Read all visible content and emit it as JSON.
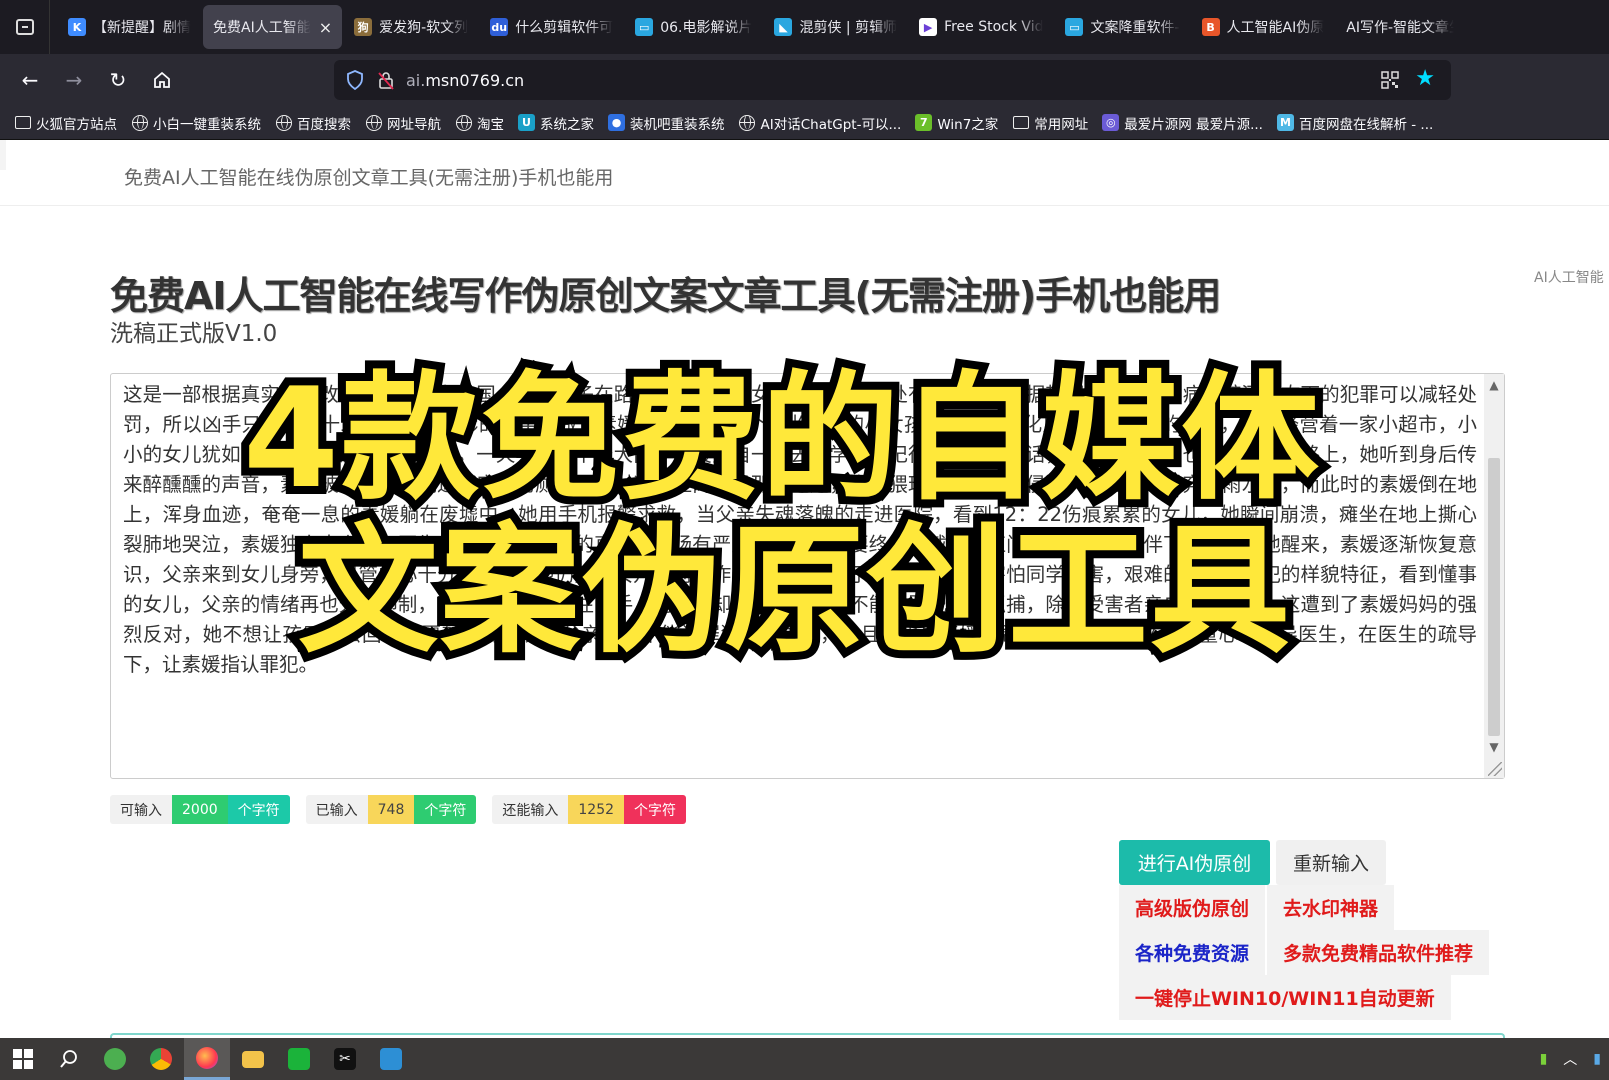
{
  "browser": {
    "tabs": [
      {
        "title": "【新提醒】剧情",
        "favicon": "k-logo-icon",
        "color": "#3f8cff",
        "glyph": "K",
        "active": false
      },
      {
        "title": "免费AI人工智能",
        "favicon": "",
        "color": "",
        "glyph": "",
        "active": true,
        "close": "×"
      },
      {
        "title": "爱发狗-软文列",
        "favicon": "dog-icon",
        "color": "#8b6d3b",
        "glyph": "狗",
        "active": false
      },
      {
        "title": "什么剪辑软件可",
        "favicon": "baidu-paw-icon",
        "color": "#2f5fd8",
        "glyph": "du",
        "active": false
      },
      {
        "title": "06.电影解说片",
        "favicon": "bilibili-tv-icon",
        "color": "#2aa7e0",
        "glyph": "▭",
        "active": false
      },
      {
        "title": "混剪侠 | 剪辑师",
        "favicon": "hunjianxia-icon",
        "color": "#2aa7e0",
        "glyph": "◣",
        "active": false
      },
      {
        "title": "Free Stock Vid",
        "favicon": "play-icon",
        "color": "#ffffff",
        "glyph": "▶",
        "active": false
      },
      {
        "title": "文案降重软件-",
        "favicon": "bilibili-tv-icon",
        "color": "#2aa7e0",
        "glyph": "▭",
        "active": false
      },
      {
        "title": "人工智能AI伪原",
        "favicon": "b-logo-icon",
        "color": "#e8562a",
        "glyph": "B",
        "active": false
      },
      {
        "title": "AI写作-智能文章生",
        "favicon": "",
        "color": "",
        "glyph": "",
        "active": false
      }
    ],
    "url_host_prefix": "ai.",
    "url_host_rest": "msn0769.cn",
    "bookmarks": [
      {
        "label": "火狐官方站点",
        "icon": "folder"
      },
      {
        "label": "小白一键重装系统",
        "icon": "globe"
      },
      {
        "label": "百度搜索",
        "icon": "globe"
      },
      {
        "label": "网址导航",
        "icon": "globe"
      },
      {
        "label": "淘宝",
        "icon": "globe"
      },
      {
        "label": "系统之家",
        "icon": "sq",
        "color": "#1aa0c8",
        "glyph": "U"
      },
      {
        "label": "装机吧重装系统",
        "icon": "sq",
        "color": "#2f6fe0",
        "glyph": "●"
      },
      {
        "label": "AI对话ChatGpt-可以...",
        "icon": "globe"
      },
      {
        "label": "Win7之家",
        "icon": "sq",
        "color": "#6bbf2a",
        "glyph": "7"
      },
      {
        "label": "常用网址",
        "icon": "folder"
      },
      {
        "label": "最爱片源网  最爱片源...",
        "icon": "sq",
        "color": "#6b5bd6",
        "glyph": "◎"
      },
      {
        "label": "百度网盘在线解析 - ...",
        "icon": "sq",
        "color": "#4fb8e6",
        "glyph": "M"
      }
    ]
  },
  "page": {
    "brand": "免费AI人工智能在线伪原创文章工具(无需注册)手机也能用",
    "side_note": "AI人工智能",
    "title": "免费AI人工智能在线写作伪原创文案文章工具(无需注册)手机也能用",
    "subtitle": "洗稿正式版V1.0",
    "editor_text": "这是一部根据真实事件改编的电影，在韩国，一名男子在路边强奸了一个女童，其后被判处有期徒刑，根据韩国法律，精神病或醉酒状态下的犯罪可以减轻处罚，所以凶手只被判了十二年，这部电影的名字叫做《素媛》。素媛是一个阳光开朗的小女孩，爸爸在文化厂里做着辛苦的工作，妈妈经营着一家小超市，小小的女儿犹如阳光一般，温暖着这个家。一天早上，下着大雨，素媛独自一人去上学，她记得妈妈说过的话，就算远一点，也要走大路。路上，她听到身后传来醉醺醺的声音，素媛被一个醉汉拖进了废弃的厕所，而对这段距离却是那么遥远，表情猥琐的醉汉将她侵犯，之后把她丢弃在雨水中，而此时的素媛倒在地上，浑身血迹，奄奄一息的素媛躺在废墟中，她用手机报警求救，当父亲失魂落魄的走进医院，看到12：22伤痕累累的女儿，她瞬间崩溃，瘫坐在地上撕心裂肺地哭泣，素媛独自去上学，医生告诉父亲，父亲的直肠到大肠有严重的损伤，需要终身佩戴人工肛门，在父母的陪伴下，她吃力地醒来，素媛逐渐恢复意识，父亲来到女儿身旁，尽管内心十分悲痛，但他仍然在女儿面前装作云淡风轻的样子，善良的素媛害怕同学受害，艰难的说出了罪犯的样貌特征，看到懂事的女儿，父亲的情绪再也无法抑制，下决心一定要抓住凶手，而警方却因证据不足，不能对罪犯进行抓捕，除非受害者亲自指认凶手，这遭到了素媛妈妈的强烈反对，她不想让孩子再去回忆那噩梦般的经历，父亲认为不能让罪犯逍遥法外，并且这也是素媛所希望的，他们找来了儿童心理辅导医生，在医生的疏导下，让素媛指认罪犯。",
    "counters": [
      {
        "label": "可输入",
        "value": "2000",
        "unit": "个字符",
        "value_color": "#2ecc71",
        "unit_color": "#1cc9a8"
      },
      {
        "label": "已输入",
        "value": "748",
        "unit": "个字符",
        "value_color": "#f8d65a",
        "unit_color": "#2ecc71"
      },
      {
        "label": "还能输入",
        "value": "1252",
        "unit": "个字符",
        "value_color": "#f8d65a",
        "unit_color": "#f0315b"
      }
    ],
    "buttons": {
      "primary": "进行AI伪原创",
      "reset": "重新输入"
    },
    "links": [
      {
        "label": "高级版伪原创",
        "color": "#e01b1b"
      },
      {
        "label": "去水印神器",
        "color": "#e01b1b"
      },
      {
        "label": "各种免费资源",
        "color": "#1b25c8"
      },
      {
        "label": "多款免费精品软件推荐",
        "color": "#e01b1b"
      },
      {
        "label": "一键停止WIN10/WIN11自动更新",
        "color": "#e01b1b"
      }
    ]
  },
  "overlay": {
    "line1": "4款免费的自媒体",
    "line2": "文案伪原创工具",
    "fill_color": "#ffe83a",
    "stroke_color": "#000000"
  },
  "taskbar": {
    "items": [
      "start-icon",
      "search-icon",
      "wechat-icon",
      "chrome-icon",
      "firefox-icon",
      "file-explorer-icon",
      "green-app-icon",
      "capcut-icon",
      "blue-app-icon"
    ]
  }
}
